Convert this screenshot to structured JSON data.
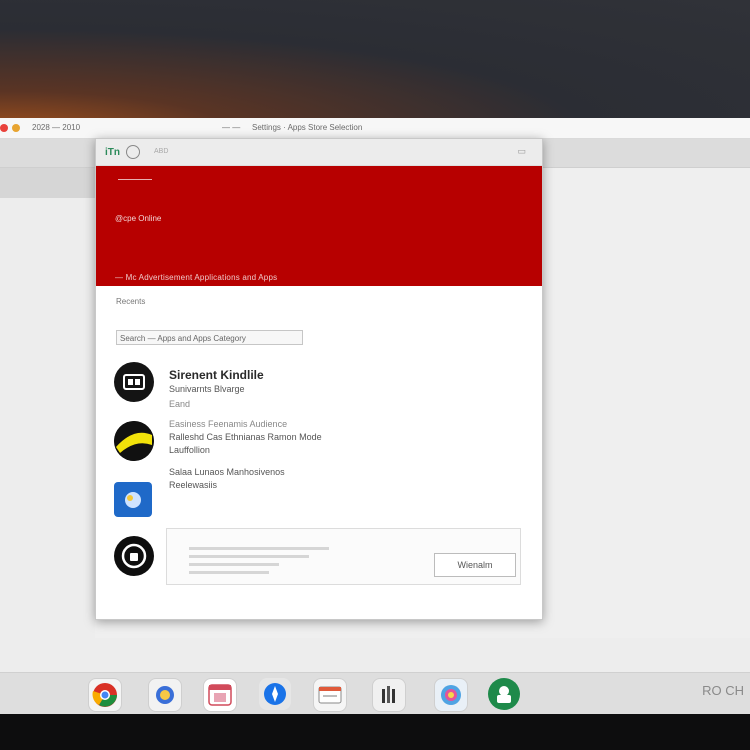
{
  "titlebar": {
    "url_text": "2028 — 2010",
    "page_text": "Settings · Apps Store Selection",
    "short_text": "— —"
  },
  "dialog": {
    "tab_label": "iTn",
    "tab_extra": "ABD",
    "close": "▭",
    "hero_subtitle": "@cpe Online",
    "hero_caption": "— Mc Advertisement Applications and Apps",
    "section_label": "Recents",
    "search_placeholder": "Search — Apps and Apps Category",
    "apps": [
      {
        "icon": "camera-icon",
        "title": "Sirenent Kindlile",
        "line1": "Sunivarnts Blvarge",
        "line2": "Eand"
      },
      {
        "icon": "sun-icon",
        "line1": "Easiness Feenamis Audience",
        "line2": "Ralleshd Cas Ethnianas Ramon Mode",
        "line3": "Lauffollion"
      },
      {
        "icon": "photos-icon",
        "line1": "Salaa Lunaos Manhosivenos",
        "line2": "Reelewasiis"
      },
      {
        "icon": "lock-icon",
        "button": "Wienalm"
      }
    ]
  },
  "dock": {
    "items": [
      "chrome-icon",
      "finder-icon",
      "calendar-icon",
      "safari-icon",
      "mail-icon",
      "launchpad-icon",
      "photos-icon",
      "android-icon"
    ],
    "label": "RO CH"
  },
  "colors": {
    "accent": "#b70000",
    "dock": "#dedede"
  }
}
